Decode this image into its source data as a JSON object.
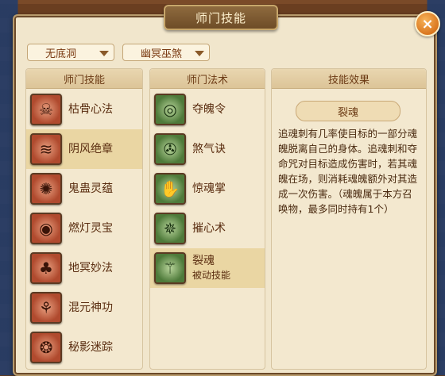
{
  "window": {
    "title": "师门技能",
    "close": "×"
  },
  "filters": {
    "sect": "无底洞",
    "school": "幽冥巫煞"
  },
  "columns": {
    "skills_header": "师门技能",
    "spells_header": "师门法术",
    "effect_header": "技能效果"
  },
  "skills": [
    {
      "label": "枯骨心法",
      "icon": "skull-staff-icon",
      "glyph": "☠"
    },
    {
      "label": "阴风绝章",
      "icon": "wind-scroll-icon",
      "glyph": "≋"
    },
    {
      "label": "鬼蛊灵蕴",
      "icon": "insect-spirit-icon",
      "glyph": "✺"
    },
    {
      "label": "燃灯灵宝",
      "icon": "lantern-disc-icon",
      "glyph": "◉"
    },
    {
      "label": "地冥妙法",
      "icon": "mushroom-spirit-icon",
      "glyph": "♣"
    },
    {
      "label": "混元神功",
      "icon": "swirl-figure-icon",
      "glyph": "⚘"
    },
    {
      "label": "秘影迷踪",
      "icon": "shadow-swirl-icon",
      "glyph": "❂"
    }
  ],
  "spells": [
    {
      "label": "夺魄令",
      "sub": "",
      "icon": "eye-seal-icon",
      "glyph": "◎"
    },
    {
      "label": "煞气诀",
      "sub": "",
      "icon": "vortex-icon",
      "glyph": "✇"
    },
    {
      "label": "惊魂掌",
      "sub": "",
      "icon": "palm-icon",
      "glyph": "✋"
    },
    {
      "label": "摧心术",
      "sub": "",
      "icon": "ghost-flame-icon",
      "glyph": "✵"
    },
    {
      "label": "裂魂",
      "sub": "被动技能",
      "icon": "split-soul-icon",
      "glyph": "⚚"
    }
  ],
  "effect": {
    "name": "裂魂",
    "text": "追魂刺有几率使目标的一部分魂魄脱离自己的身体。追魂刺和夺命咒对目标造成伤害时，若其魂魄在场，则消耗魂魄额外对其造成一次伤害。（魂魄属于本方召唤物，最多同时持有1个）"
  }
}
